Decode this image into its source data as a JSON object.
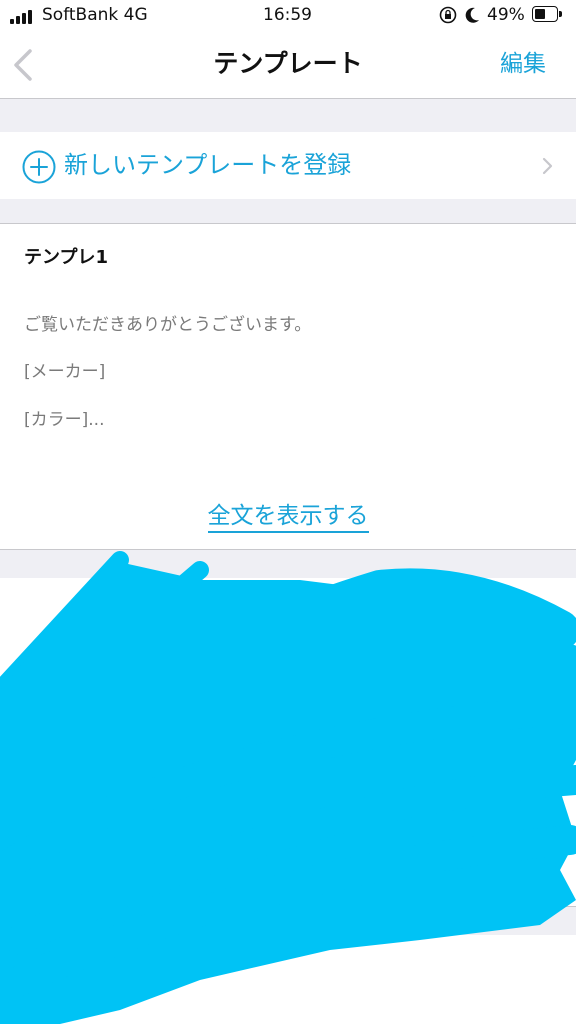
{
  "status_bar": {
    "carrier": "SoftBank 4G",
    "time": "16:59",
    "battery_percent": "49%",
    "battery_level": 0.49,
    "icons": [
      "signal-icon",
      "rotation-lock-icon",
      "moon-icon",
      "battery-icon"
    ]
  },
  "nav": {
    "title": "テンプレート",
    "edit_label": "編集",
    "back_icon": "chevron-left-icon"
  },
  "new_template": {
    "label": "新しいテンプレートを登録",
    "icon": "plus-circle-icon"
  },
  "templates": [
    {
      "title": "テンプレ1",
      "lines": [
        "ご覧いただきありがとうございます。",
        "[メーカー]",
        "[カラー]..."
      ],
      "show_all_label": "全文を表示する"
    }
  ],
  "colors": {
    "accent": "#1aa3d8",
    "background_gray": "#efeff4",
    "redaction": "#00c3f5"
  }
}
